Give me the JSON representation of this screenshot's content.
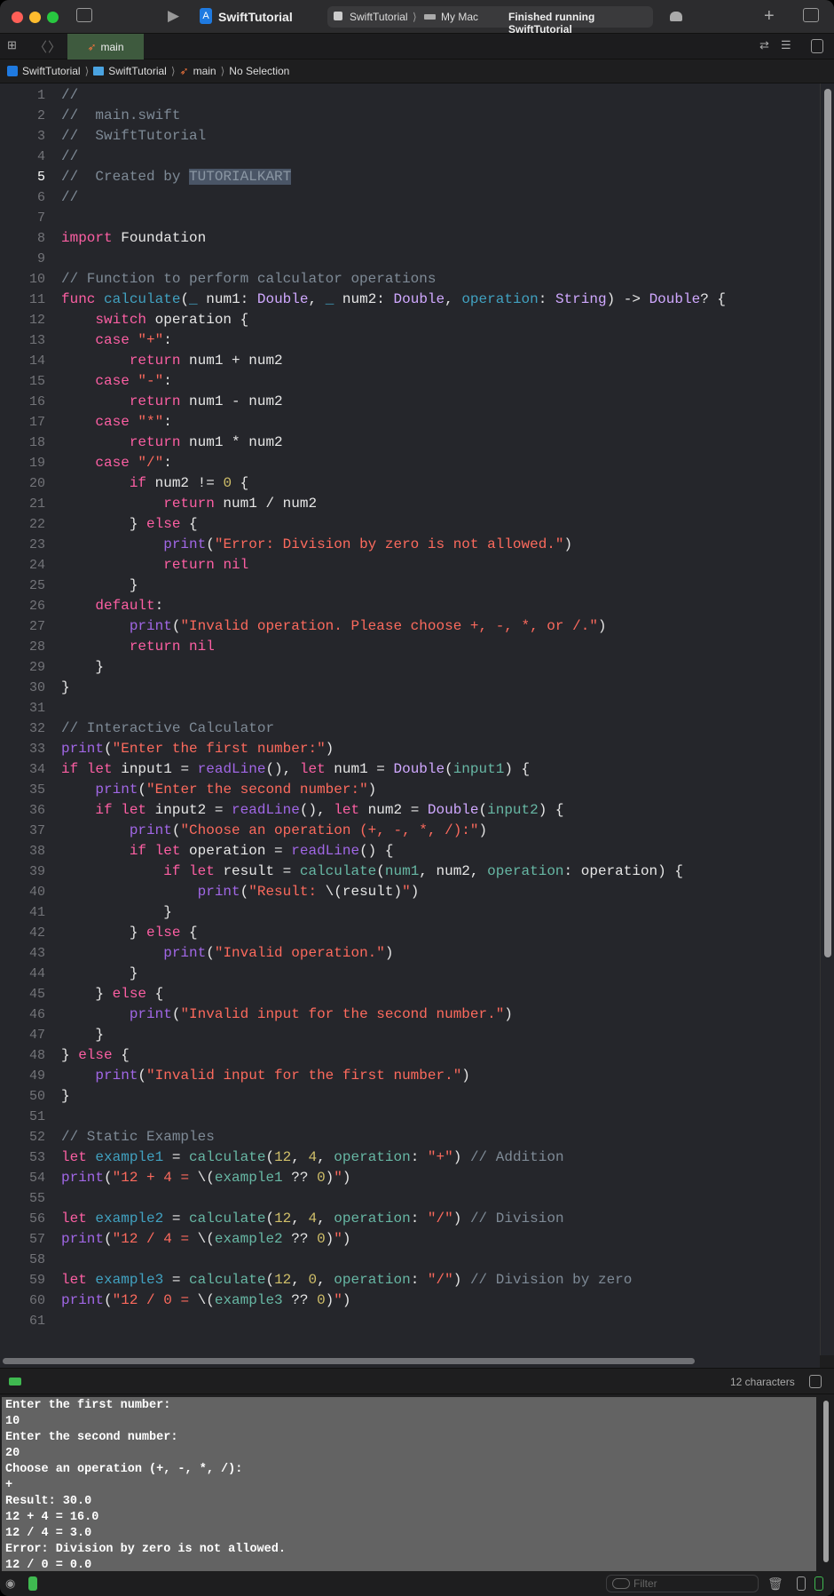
{
  "window": {
    "title": "SwiftTutorial"
  },
  "scheme": {
    "target": "SwiftTutorial",
    "destination": "My Mac",
    "status": "Finished running SwiftTutorial"
  },
  "tabs": [
    {
      "label": "main",
      "active": true
    }
  ],
  "breadcrumb": [
    "SwiftTutorial",
    "SwiftTutorial",
    "main",
    "No Selection"
  ],
  "editor": {
    "current_line": 5,
    "lines": [
      [
        [
          "c",
          "//"
        ]
      ],
      [
        [
          "c",
          "//  main.swift"
        ]
      ],
      [
        [
          "c",
          "//  SwiftTutorial"
        ]
      ],
      [
        [
          "c",
          "//"
        ]
      ],
      [
        [
          "c",
          "//  Created by "
        ],
        [
          "hl",
          "TUTORIALKART"
        ]
      ],
      [
        [
          "c",
          "//"
        ]
      ],
      [],
      [
        [
          "k",
          "import"
        ],
        [
          "x",
          " Foundation"
        ]
      ],
      [],
      [
        [
          "c",
          "// Function to perform calculator operations"
        ]
      ],
      [
        [
          "k",
          "func"
        ],
        [
          "x",
          " "
        ],
        [
          "d",
          "calculate"
        ],
        [
          "x",
          "("
        ],
        [
          "d",
          "_"
        ],
        [
          "x",
          " num1: "
        ],
        [
          "t",
          "Double"
        ],
        [
          "x",
          ", "
        ],
        [
          "d",
          "_"
        ],
        [
          "x",
          " num2: "
        ],
        [
          "t",
          "Double"
        ],
        [
          "x",
          ", "
        ],
        [
          "d",
          "operation"
        ],
        [
          "x",
          ": "
        ],
        [
          "t",
          "String"
        ],
        [
          "x",
          ") -> "
        ],
        [
          "t",
          "Double"
        ],
        [
          "x",
          "? {"
        ]
      ],
      [
        [
          "x",
          "    "
        ],
        [
          "k",
          "switch"
        ],
        [
          "x",
          " operation {"
        ]
      ],
      [
        [
          "x",
          "    "
        ],
        [
          "k",
          "case"
        ],
        [
          "x",
          " "
        ],
        [
          "s",
          "\"+\""
        ],
        [
          "x",
          ":"
        ]
      ],
      [
        [
          "x",
          "        "
        ],
        [
          "k",
          "return"
        ],
        [
          "x",
          " num1 + num2"
        ]
      ],
      [
        [
          "x",
          "    "
        ],
        [
          "k",
          "case"
        ],
        [
          "x",
          " "
        ],
        [
          "s",
          "\"-\""
        ],
        [
          "x",
          ":"
        ]
      ],
      [
        [
          "x",
          "        "
        ],
        [
          "k",
          "return"
        ],
        [
          "x",
          " num1 - num2"
        ]
      ],
      [
        [
          "x",
          "    "
        ],
        [
          "k",
          "case"
        ],
        [
          "x",
          " "
        ],
        [
          "s",
          "\"*\""
        ],
        [
          "x",
          ":"
        ]
      ],
      [
        [
          "x",
          "        "
        ],
        [
          "k",
          "return"
        ],
        [
          "x",
          " num1 * num2"
        ]
      ],
      [
        [
          "x",
          "    "
        ],
        [
          "k",
          "case"
        ],
        [
          "x",
          " "
        ],
        [
          "s",
          "\"/\""
        ],
        [
          "x",
          ":"
        ]
      ],
      [
        [
          "x",
          "        "
        ],
        [
          "k",
          "if"
        ],
        [
          "x",
          " num2 != "
        ],
        [
          "n",
          "0"
        ],
        [
          "x",
          " {"
        ]
      ],
      [
        [
          "x",
          "            "
        ],
        [
          "k",
          "return"
        ],
        [
          "x",
          " num1 / num2"
        ]
      ],
      [
        [
          "x",
          "        } "
        ],
        [
          "k",
          "else"
        ],
        [
          "x",
          " {"
        ]
      ],
      [
        [
          "x",
          "            "
        ],
        [
          "f",
          "print"
        ],
        [
          "x",
          "("
        ],
        [
          "s",
          "\"Error: Division by zero is not allowed.\""
        ],
        [
          "x",
          ")"
        ]
      ],
      [
        [
          "x",
          "            "
        ],
        [
          "k",
          "return"
        ],
        [
          "x",
          " "
        ],
        [
          "k",
          "nil"
        ]
      ],
      [
        [
          "x",
          "        }"
        ]
      ],
      [
        [
          "x",
          "    "
        ],
        [
          "k",
          "default"
        ],
        [
          "x",
          ":"
        ]
      ],
      [
        [
          "x",
          "        "
        ],
        [
          "f",
          "print"
        ],
        [
          "x",
          "("
        ],
        [
          "s",
          "\"Invalid operation. Please choose +, -, *, or /.\""
        ],
        [
          "x",
          ")"
        ]
      ],
      [
        [
          "x",
          "        "
        ],
        [
          "k",
          "return"
        ],
        [
          "x",
          " "
        ],
        [
          "k",
          "nil"
        ]
      ],
      [
        [
          "x",
          "    }"
        ]
      ],
      [
        [
          "x",
          "}"
        ]
      ],
      [],
      [
        [
          "c",
          "// Interactive Calculator"
        ]
      ],
      [
        [
          "f",
          "print"
        ],
        [
          "x",
          "("
        ],
        [
          "s",
          "\"Enter the first number:\""
        ],
        [
          "x",
          ")"
        ]
      ],
      [
        [
          "k",
          "if"
        ],
        [
          "x",
          " "
        ],
        [
          "k",
          "let"
        ],
        [
          "x",
          " input1 = "
        ],
        [
          "f",
          "readLine"
        ],
        [
          "x",
          "(), "
        ],
        [
          "k",
          "let"
        ],
        [
          "x",
          " num1 = "
        ],
        [
          "t",
          "Double"
        ],
        [
          "x",
          "("
        ],
        [
          "p",
          "input1"
        ],
        [
          "x",
          ") {"
        ]
      ],
      [
        [
          "x",
          "    "
        ],
        [
          "f",
          "print"
        ],
        [
          "x",
          "("
        ],
        [
          "s",
          "\"Enter the second number:\""
        ],
        [
          "x",
          ")"
        ]
      ],
      [
        [
          "x",
          "    "
        ],
        [
          "k",
          "if"
        ],
        [
          "x",
          " "
        ],
        [
          "k",
          "let"
        ],
        [
          "x",
          " input2 = "
        ],
        [
          "f",
          "readLine"
        ],
        [
          "x",
          "(), "
        ],
        [
          "k",
          "let"
        ],
        [
          "x",
          " num2 = "
        ],
        [
          "t",
          "Double"
        ],
        [
          "x",
          "("
        ],
        [
          "p",
          "input2"
        ],
        [
          "x",
          ") {"
        ]
      ],
      [
        [
          "x",
          "        "
        ],
        [
          "f",
          "print"
        ],
        [
          "x",
          "("
        ],
        [
          "s",
          "\"Choose an operation (+, -, *, /):\""
        ],
        [
          "x",
          ")"
        ]
      ],
      [
        [
          "x",
          "        "
        ],
        [
          "k",
          "if"
        ],
        [
          "x",
          " "
        ],
        [
          "k",
          "let"
        ],
        [
          "x",
          " operation = "
        ],
        [
          "f",
          "readLine"
        ],
        [
          "x",
          "() {"
        ]
      ],
      [
        [
          "x",
          "            "
        ],
        [
          "k",
          "if"
        ],
        [
          "x",
          " "
        ],
        [
          "k",
          "let"
        ],
        [
          "x",
          " result = "
        ],
        [
          "p",
          "calculate"
        ],
        [
          "x",
          "("
        ],
        [
          "p",
          "num1"
        ],
        [
          "x",
          ", num2, "
        ],
        [
          "p",
          "operation"
        ],
        [
          "x",
          ": operation) {"
        ]
      ],
      [
        [
          "x",
          "                "
        ],
        [
          "f",
          "print"
        ],
        [
          "x",
          "("
        ],
        [
          "s",
          "\"Result: "
        ],
        [
          "x",
          "\\(result)"
        ],
        [
          "s",
          "\""
        ],
        [
          "x",
          ")"
        ]
      ],
      [
        [
          "x",
          "            }"
        ]
      ],
      [
        [
          "x",
          "        } "
        ],
        [
          "k",
          "else"
        ],
        [
          "x",
          " {"
        ]
      ],
      [
        [
          "x",
          "            "
        ],
        [
          "f",
          "print"
        ],
        [
          "x",
          "("
        ],
        [
          "s",
          "\"Invalid operation.\""
        ],
        [
          "x",
          ")"
        ]
      ],
      [
        [
          "x",
          "        }"
        ]
      ],
      [
        [
          "x",
          "    } "
        ],
        [
          "k",
          "else"
        ],
        [
          "x",
          " {"
        ]
      ],
      [
        [
          "x",
          "        "
        ],
        [
          "f",
          "print"
        ],
        [
          "x",
          "("
        ],
        [
          "s",
          "\"Invalid input for the second number.\""
        ],
        [
          "x",
          ")"
        ]
      ],
      [
        [
          "x",
          "    }"
        ]
      ],
      [
        [
          "x",
          "} "
        ],
        [
          "k",
          "else"
        ],
        [
          "x",
          " {"
        ]
      ],
      [
        [
          "x",
          "    "
        ],
        [
          "f",
          "print"
        ],
        [
          "x",
          "("
        ],
        [
          "s",
          "\"Invalid input for the first number.\""
        ],
        [
          "x",
          ")"
        ]
      ],
      [
        [
          "x",
          "}"
        ]
      ],
      [],
      [
        [
          "c",
          "// Static Examples"
        ]
      ],
      [
        [
          "k",
          "let"
        ],
        [
          "x",
          " "
        ],
        [
          "d",
          "example1"
        ],
        [
          "x",
          " = "
        ],
        [
          "p",
          "calculate"
        ],
        [
          "x",
          "("
        ],
        [
          "n",
          "12"
        ],
        [
          "x",
          ", "
        ],
        [
          "n",
          "4"
        ],
        [
          "x",
          ", "
        ],
        [
          "p",
          "operation"
        ],
        [
          "x",
          ": "
        ],
        [
          "s",
          "\"+\""
        ],
        [
          "x",
          ") "
        ],
        [
          "c",
          "// Addition"
        ]
      ],
      [
        [
          "f",
          "print"
        ],
        [
          "x",
          "("
        ],
        [
          "s",
          "\"12 + 4 = "
        ],
        [
          "x",
          "\\("
        ],
        [
          "p",
          "example1"
        ],
        [
          "x",
          " ?? "
        ],
        [
          "n",
          "0"
        ],
        [
          "x",
          ")"
        ],
        [
          "s",
          "\""
        ],
        [
          "x",
          ")"
        ]
      ],
      [],
      [
        [
          "k",
          "let"
        ],
        [
          "x",
          " "
        ],
        [
          "d",
          "example2"
        ],
        [
          "x",
          " = "
        ],
        [
          "p",
          "calculate"
        ],
        [
          "x",
          "("
        ],
        [
          "n",
          "12"
        ],
        [
          "x",
          ", "
        ],
        [
          "n",
          "4"
        ],
        [
          "x",
          ", "
        ],
        [
          "p",
          "operation"
        ],
        [
          "x",
          ": "
        ],
        [
          "s",
          "\"/\""
        ],
        [
          "x",
          ") "
        ],
        [
          "c",
          "// Division"
        ]
      ],
      [
        [
          "f",
          "print"
        ],
        [
          "x",
          "("
        ],
        [
          "s",
          "\"12 / 4 = "
        ],
        [
          "x",
          "\\("
        ],
        [
          "p",
          "example2"
        ],
        [
          "x",
          " ?? "
        ],
        [
          "n",
          "0"
        ],
        [
          "x",
          ")"
        ],
        [
          "s",
          "\""
        ],
        [
          "x",
          ")"
        ]
      ],
      [],
      [
        [
          "k",
          "let"
        ],
        [
          "x",
          " "
        ],
        [
          "d",
          "example3"
        ],
        [
          "x",
          " = "
        ],
        [
          "p",
          "calculate"
        ],
        [
          "x",
          "("
        ],
        [
          "n",
          "12"
        ],
        [
          "x",
          ", "
        ],
        [
          "n",
          "0"
        ],
        [
          "x",
          ", "
        ],
        [
          "p",
          "operation"
        ],
        [
          "x",
          ": "
        ],
        [
          "s",
          "\"/\""
        ],
        [
          "x",
          ") "
        ],
        [
          "c",
          "// Division by zero"
        ]
      ],
      [
        [
          "f",
          "print"
        ],
        [
          "x",
          "("
        ],
        [
          "s",
          "\"12 / 0 = "
        ],
        [
          "x",
          "\\("
        ],
        [
          "p",
          "example3"
        ],
        [
          "x",
          " ?? "
        ],
        [
          "n",
          "0"
        ],
        [
          "x",
          ")"
        ],
        [
          "s",
          "\""
        ],
        [
          "x",
          ")"
        ]
      ],
      []
    ]
  },
  "console": {
    "char_count": "12 characters",
    "output": [
      "Enter the first number:",
      "10",
      "Enter the second number:",
      "20",
      "Choose an operation (+, -, *, /):",
      "+",
      "Result: 30.0",
      "12 + 4 = 16.0",
      "12 / 4 = 3.0",
      "Error: Division by zero is not allowed.",
      "12 / 0 = 0.0"
    ],
    "filter_placeholder": "Filter"
  },
  "colors": {
    "keyword": "#fc5fa3",
    "string": "#fc6a5d",
    "comment": "#7e8a96",
    "type": "#d0a8ff",
    "declaration": "#41a1c0",
    "project": "#67b7a4",
    "function": "#a167e6",
    "number": "#d0bf69",
    "tab_active": "#3e5a3e",
    "console_bg": "#636363"
  }
}
